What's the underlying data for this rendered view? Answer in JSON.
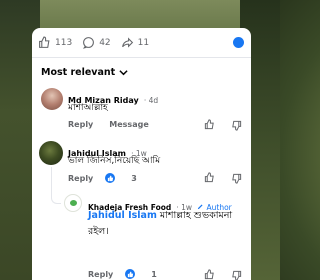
{
  "reactions": {
    "likes": "113",
    "comments": "42",
    "shares": "11"
  },
  "sort_label": "Most relevant",
  "comments": [
    {
      "author": "Md Mizan Riday",
      "time": "· 4d",
      "text": "মাশাআল্লাহ",
      "reply_label": "Reply",
      "message_label": "Message"
    },
    {
      "author": "Jahidul Islam",
      "time": "· 1w",
      "text": "ভাল জিনিস,নিয়েছি আমি",
      "reply_label": "Reply",
      "like_count": "3",
      "reply": {
        "author": "Khadeja Fresh Food",
        "time": "· 1w",
        "author_badge": "Author",
        "mention": "Jahidul Islam",
        "text": " মাশাল্লাহ শুভকামনা রইল।",
        "reply_label": "Reply",
        "like_count": "1"
      }
    }
  ],
  "colors": {
    "accent": "#1877f2",
    "muted": "#65676b",
    "text": "#050505"
  }
}
